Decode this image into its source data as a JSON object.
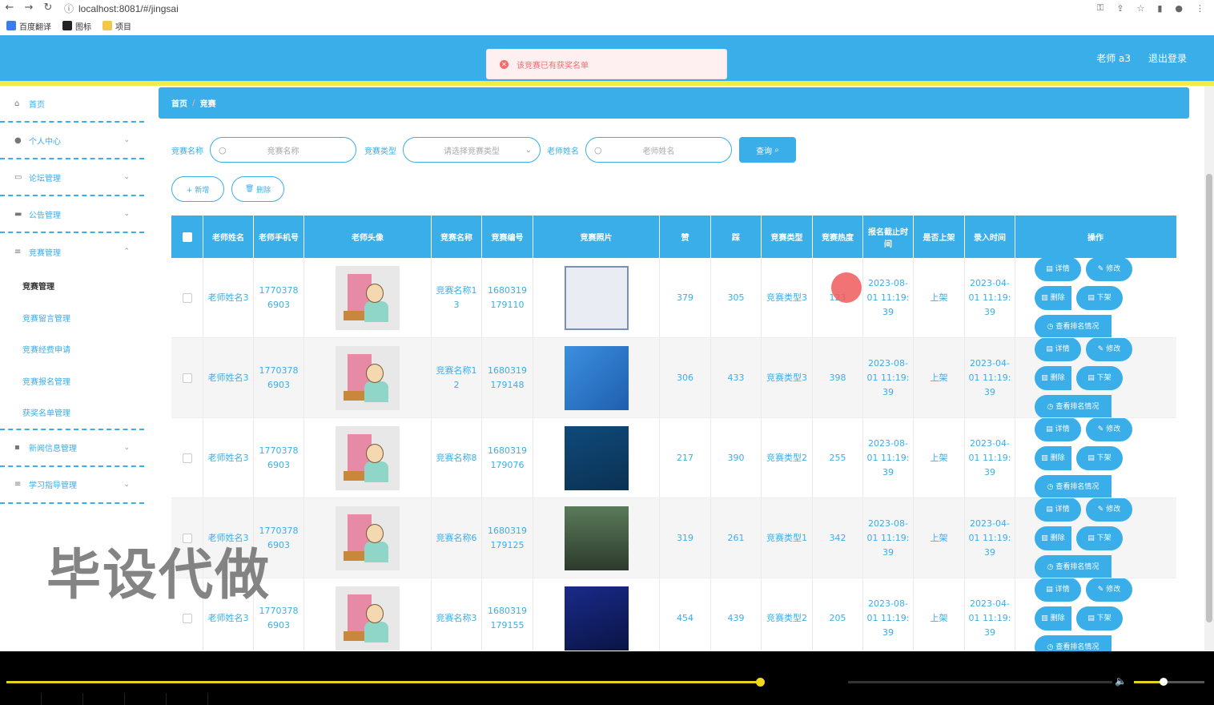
{
  "browser": {
    "url": "localhost:8081/#/jingsai",
    "bookmarks": [
      "百度翻译",
      "图标",
      "项目"
    ]
  },
  "header": {
    "user_label": "老师 a3",
    "logout_label": "退出登录",
    "accent": "#3aaee8",
    "stripe": "#f2ea46"
  },
  "toast": {
    "message": "该竞赛已有获奖名单"
  },
  "sidebar": {
    "home": "首页",
    "personal": "个人中心",
    "forum": "论坛管理",
    "notice": "公告管理",
    "contest": "竞赛管理",
    "contest_subs": [
      "竞赛管理",
      "竞赛留言管理",
      "竞赛经费申请",
      "竞赛报名管理",
      "获奖名单管理"
    ],
    "news": "新闻信息管理",
    "study": "学习指导管理"
  },
  "breadcrumb": {
    "home": "首页",
    "sep": "/",
    "current": "竞赛"
  },
  "search": {
    "name_label": "竞赛名称",
    "name_placeholder": "竞赛名称",
    "type_label": "竞赛类型",
    "type_placeholder": "请选择竞赛类型",
    "teacher_label": "老师姓名",
    "teacher_placeholder": "老师姓名",
    "query_label": "查询"
  },
  "toolbar": {
    "add_label": "+ 新增",
    "delete_label": "删除"
  },
  "table": {
    "headers": [
      "老师姓名",
      "老师手机号",
      "老师头像",
      "竞赛名称",
      "竞赛编号",
      "竞赛照片",
      "赞",
      "踩",
      "竞赛类型",
      "竞赛热度",
      "报名截止时间",
      "是否上架",
      "录入时间",
      "操作"
    ],
    "ops": {
      "detail": "详情",
      "edit": "修改",
      "delete": "删除",
      "off": "下架",
      "rank": "查看排名情况"
    },
    "rows": [
      {
        "teacher": "老师姓名3",
        "phone": "17703786903",
        "name": "竞赛名称13",
        "code": "1680319179110",
        "like": "379",
        "dislike": "305",
        "type": "竞赛类型3",
        "heat": "123",
        "deadline": "2023-08-01 11:19:39",
        "onsale": "上架",
        "created": "2023-04-01 11:19:39"
      },
      {
        "teacher": "老师姓名3",
        "phone": "17703786903",
        "name": "竞赛名称12",
        "code": "1680319179148",
        "like": "306",
        "dislike": "433",
        "type": "竞赛类型3",
        "heat": "398",
        "deadline": "2023-08-01 11:19:39",
        "onsale": "上架",
        "created": "2023-04-01 11:19:39"
      },
      {
        "teacher": "老师姓名3",
        "phone": "17703786903",
        "name": "竞赛名称8",
        "code": "1680319179076",
        "like": "217",
        "dislike": "390",
        "type": "竞赛类型2",
        "heat": "255",
        "deadline": "2023-08-01 11:19:39",
        "onsale": "上架",
        "created": "2023-04-01 11:19:39"
      },
      {
        "teacher": "老师姓名3",
        "phone": "17703786903",
        "name": "竞赛名称6",
        "code": "1680319179125",
        "like": "319",
        "dislike": "261",
        "type": "竞赛类型1",
        "heat": "342",
        "deadline": "2023-08-01 11:19:39",
        "onsale": "上架",
        "created": "2023-04-01 11:19:39"
      },
      {
        "teacher": "老师姓名3",
        "phone": "17703786903",
        "name": "竞赛名称3",
        "code": "1680319179155",
        "like": "454",
        "dislike": "439",
        "type": "竞赛类型2",
        "heat": "205",
        "deadline": "2023-08-01 11:19:39",
        "onsale": "上架",
        "created": "2023-04-01 11:19:39"
      }
    ]
  },
  "watermark": "毕设代做",
  "player": {
    "progress": 0.69,
    "volume": 0.6
  }
}
